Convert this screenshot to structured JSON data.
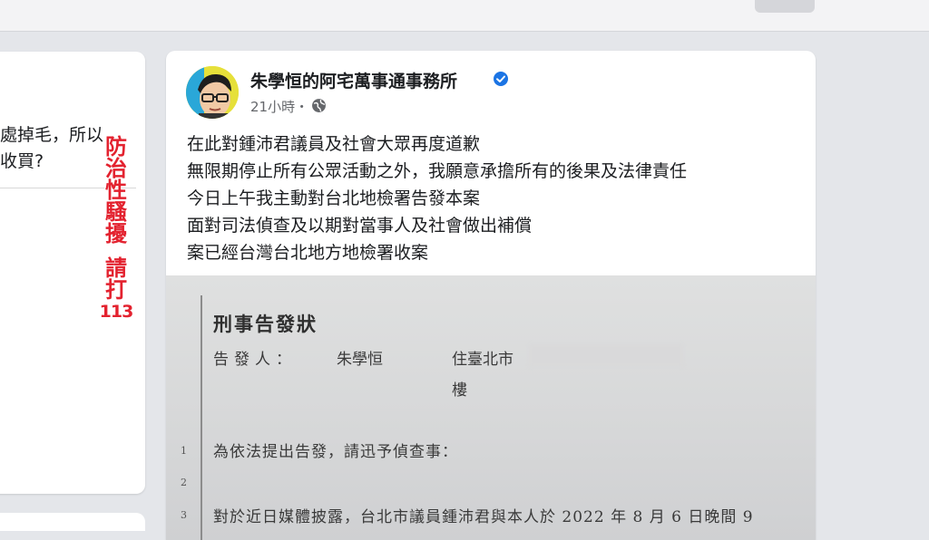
{
  "left_card": {
    "line1": "處掉毛，所以",
    "line2": "收買?"
  },
  "overlay": {
    "chars_top": [
      "防",
      "治",
      "性",
      "騷",
      "擾"
    ],
    "chars_bottom": [
      "請",
      "打"
    ],
    "number": "113",
    "color": "#e3222f"
  },
  "post": {
    "author": "朱學恒的阿宅萬事通事務所",
    "timestamp": "21小時・",
    "verified_icon": "verified-badge-icon",
    "privacy_icon": "globe-icon",
    "lines": [
      "在此對鍾沛君議員及社會大眾再度道歉",
      "無限期停止所有公眾活動之外，我願意承擔所有的後果及法律責任",
      "今日上午我主動對台北地檢署告發本案",
      "面對司法偵查及以期對當事人及社會做出補償",
      "案已經台灣台北地方地檢署收案"
    ]
  },
  "document": {
    "title": "刑事告發狀",
    "label": "告發人：",
    "name": "朱學恒",
    "address": "住臺北市",
    "floor": "樓",
    "line_numbers": [
      "1",
      "2",
      "3"
    ],
    "line1": "為依法提出告發，請迅予偵查事：",
    "line3": "對於近日媒體披露，台北市議員鍾沛君與本人於 2022 年 8 月 6 日晚間 9"
  },
  "colors": {
    "page_bg": "#e4e6ea",
    "card_bg": "#ffffff",
    "verified": "#1b74e4"
  }
}
